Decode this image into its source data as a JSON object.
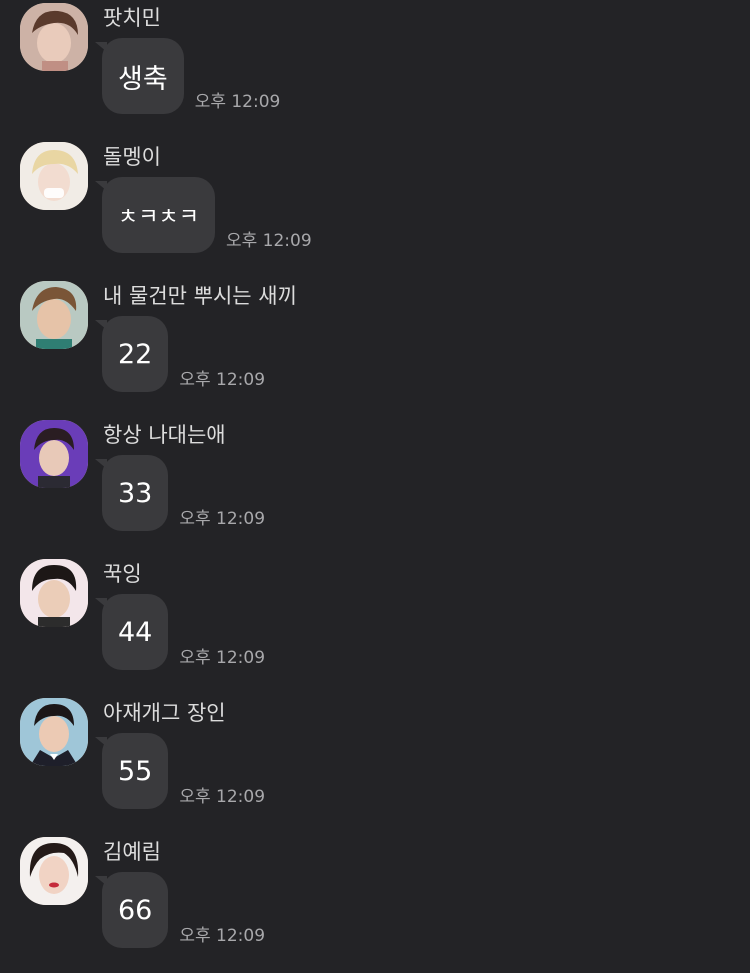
{
  "messages": [
    {
      "sender": "팟치민",
      "text": "생축",
      "time": "오후 12:09",
      "avatar_icon": "avatar-boy-light-hair-icon"
    },
    {
      "sender": "돌멩이",
      "text": "ㅊㅋㅊㅋ",
      "time": "오후 12:09",
      "avatar_icon": "avatar-blond-hair-icon"
    },
    {
      "sender": "내 물건만 뿌시는 새끼",
      "text": "22",
      "time": "오후 12:09",
      "avatar_icon": "avatar-smiling-boy-icon"
    },
    {
      "sender": "항상 나대는애",
      "text": "33",
      "time": "오후 12:09",
      "avatar_icon": "avatar-purple-background-icon"
    },
    {
      "sender": "꾹잉",
      "text": "44",
      "time": "오후 12:09",
      "avatar_icon": "avatar-dark-hair-boy-icon"
    },
    {
      "sender": "아재개그 장인",
      "text": "55",
      "time": "오후 12:09",
      "avatar_icon": "avatar-suit-boy-icon"
    },
    {
      "sender": "김예림",
      "text": "66",
      "time": "오후 12:09",
      "avatar_icon": "avatar-girl-red-lips-icon"
    }
  ],
  "colors": {
    "background": "#232326",
    "bubble": "#3a3a3d",
    "sender_text": "#dcdcdc",
    "time_text": "#a8a8ab"
  }
}
